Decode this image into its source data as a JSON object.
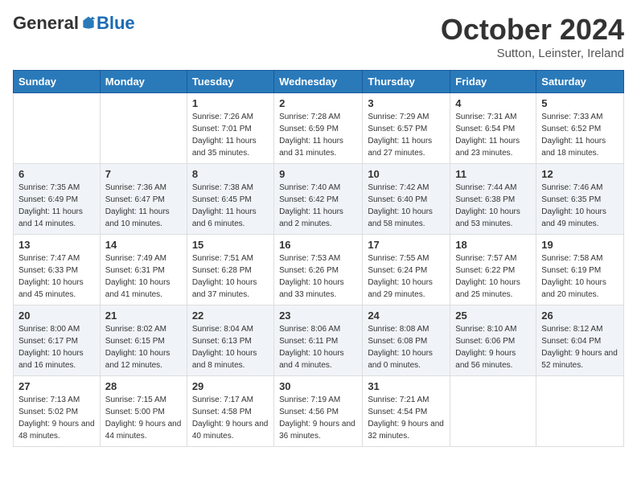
{
  "logo": {
    "general": "General",
    "blue": "Blue"
  },
  "title": "October 2024",
  "subtitle": "Sutton, Leinster, Ireland",
  "days_header": [
    "Sunday",
    "Monday",
    "Tuesday",
    "Wednesday",
    "Thursday",
    "Friday",
    "Saturday"
  ],
  "weeks": [
    [
      {
        "num": "",
        "detail": ""
      },
      {
        "num": "",
        "detail": ""
      },
      {
        "num": "1",
        "detail": "Sunrise: 7:26 AM\nSunset: 7:01 PM\nDaylight: 11 hours and 35 minutes."
      },
      {
        "num": "2",
        "detail": "Sunrise: 7:28 AM\nSunset: 6:59 PM\nDaylight: 11 hours and 31 minutes."
      },
      {
        "num": "3",
        "detail": "Sunrise: 7:29 AM\nSunset: 6:57 PM\nDaylight: 11 hours and 27 minutes."
      },
      {
        "num": "4",
        "detail": "Sunrise: 7:31 AM\nSunset: 6:54 PM\nDaylight: 11 hours and 23 minutes."
      },
      {
        "num": "5",
        "detail": "Sunrise: 7:33 AM\nSunset: 6:52 PM\nDaylight: 11 hours and 18 minutes."
      }
    ],
    [
      {
        "num": "6",
        "detail": "Sunrise: 7:35 AM\nSunset: 6:49 PM\nDaylight: 11 hours and 14 minutes."
      },
      {
        "num": "7",
        "detail": "Sunrise: 7:36 AM\nSunset: 6:47 PM\nDaylight: 11 hours and 10 minutes."
      },
      {
        "num": "8",
        "detail": "Sunrise: 7:38 AM\nSunset: 6:45 PM\nDaylight: 11 hours and 6 minutes."
      },
      {
        "num": "9",
        "detail": "Sunrise: 7:40 AM\nSunset: 6:42 PM\nDaylight: 11 hours and 2 minutes."
      },
      {
        "num": "10",
        "detail": "Sunrise: 7:42 AM\nSunset: 6:40 PM\nDaylight: 10 hours and 58 minutes."
      },
      {
        "num": "11",
        "detail": "Sunrise: 7:44 AM\nSunset: 6:38 PM\nDaylight: 10 hours and 53 minutes."
      },
      {
        "num": "12",
        "detail": "Sunrise: 7:46 AM\nSunset: 6:35 PM\nDaylight: 10 hours and 49 minutes."
      }
    ],
    [
      {
        "num": "13",
        "detail": "Sunrise: 7:47 AM\nSunset: 6:33 PM\nDaylight: 10 hours and 45 minutes."
      },
      {
        "num": "14",
        "detail": "Sunrise: 7:49 AM\nSunset: 6:31 PM\nDaylight: 10 hours and 41 minutes."
      },
      {
        "num": "15",
        "detail": "Sunrise: 7:51 AM\nSunset: 6:28 PM\nDaylight: 10 hours and 37 minutes."
      },
      {
        "num": "16",
        "detail": "Sunrise: 7:53 AM\nSunset: 6:26 PM\nDaylight: 10 hours and 33 minutes."
      },
      {
        "num": "17",
        "detail": "Sunrise: 7:55 AM\nSunset: 6:24 PM\nDaylight: 10 hours and 29 minutes."
      },
      {
        "num": "18",
        "detail": "Sunrise: 7:57 AM\nSunset: 6:22 PM\nDaylight: 10 hours and 25 minutes."
      },
      {
        "num": "19",
        "detail": "Sunrise: 7:58 AM\nSunset: 6:19 PM\nDaylight: 10 hours and 20 minutes."
      }
    ],
    [
      {
        "num": "20",
        "detail": "Sunrise: 8:00 AM\nSunset: 6:17 PM\nDaylight: 10 hours and 16 minutes."
      },
      {
        "num": "21",
        "detail": "Sunrise: 8:02 AM\nSunset: 6:15 PM\nDaylight: 10 hours and 12 minutes."
      },
      {
        "num": "22",
        "detail": "Sunrise: 8:04 AM\nSunset: 6:13 PM\nDaylight: 10 hours and 8 minutes."
      },
      {
        "num": "23",
        "detail": "Sunrise: 8:06 AM\nSunset: 6:11 PM\nDaylight: 10 hours and 4 minutes."
      },
      {
        "num": "24",
        "detail": "Sunrise: 8:08 AM\nSunset: 6:08 PM\nDaylight: 10 hours and 0 minutes."
      },
      {
        "num": "25",
        "detail": "Sunrise: 8:10 AM\nSunset: 6:06 PM\nDaylight: 9 hours and 56 minutes."
      },
      {
        "num": "26",
        "detail": "Sunrise: 8:12 AM\nSunset: 6:04 PM\nDaylight: 9 hours and 52 minutes."
      }
    ],
    [
      {
        "num": "27",
        "detail": "Sunrise: 7:13 AM\nSunset: 5:02 PM\nDaylight: 9 hours and 48 minutes."
      },
      {
        "num": "28",
        "detail": "Sunrise: 7:15 AM\nSunset: 5:00 PM\nDaylight: 9 hours and 44 minutes."
      },
      {
        "num": "29",
        "detail": "Sunrise: 7:17 AM\nSunset: 4:58 PM\nDaylight: 9 hours and 40 minutes."
      },
      {
        "num": "30",
        "detail": "Sunrise: 7:19 AM\nSunset: 4:56 PM\nDaylight: 9 hours and 36 minutes."
      },
      {
        "num": "31",
        "detail": "Sunrise: 7:21 AM\nSunset: 4:54 PM\nDaylight: 9 hours and 32 minutes."
      },
      {
        "num": "",
        "detail": ""
      },
      {
        "num": "",
        "detail": ""
      }
    ]
  ]
}
